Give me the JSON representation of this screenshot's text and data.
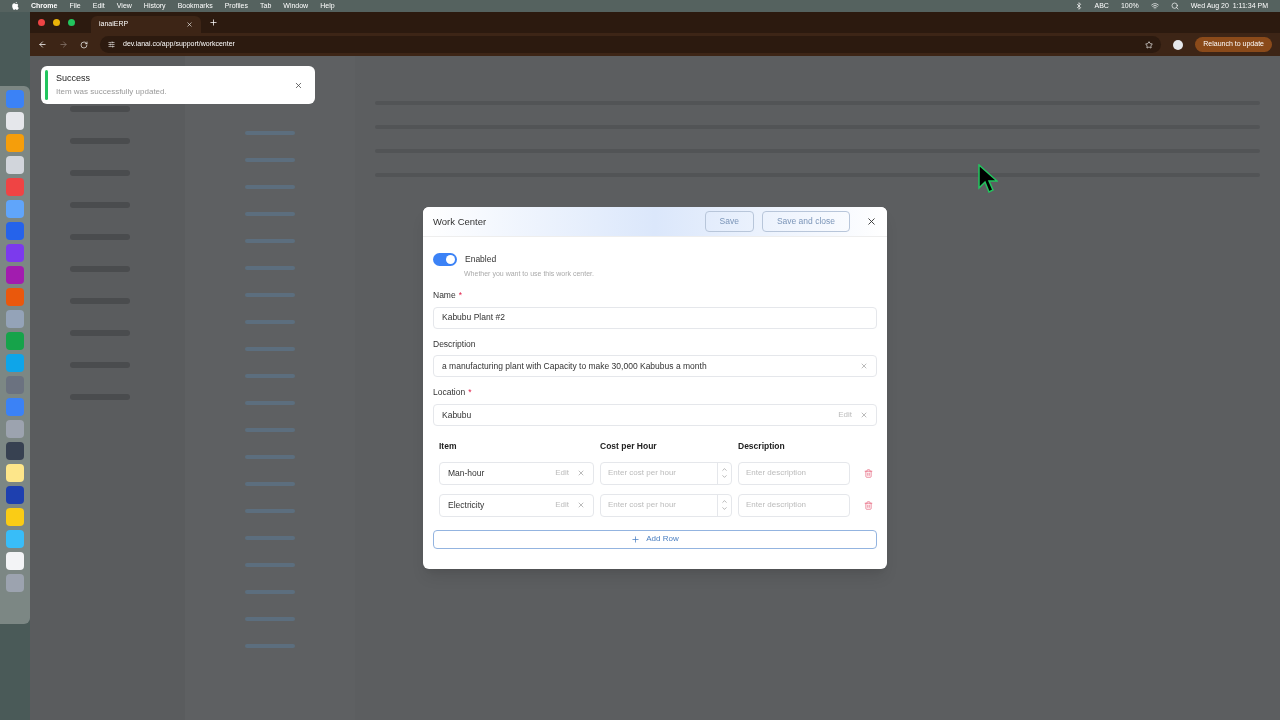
{
  "menubar": {
    "app": "Chrome",
    "menus": [
      "File",
      "Edit",
      "View",
      "History",
      "Bookmarks",
      "Profiles",
      "Tab",
      "Window",
      "Help"
    ],
    "status": [
      "ABC",
      "100%"
    ],
    "clock": "Wed Aug 20  1:11:34 PM"
  },
  "browser": {
    "tab_title": "ianaiERP",
    "url": "dev.ianai.co/app/support/workcenter",
    "relaunch_label": "Relaunch to update"
  },
  "toast": {
    "title": "Success",
    "message": "Item was successfully updated."
  },
  "dialog": {
    "title": "Work Center",
    "buttons": [
      {
        "label": "Save",
        "kind": "outline"
      },
      {
        "label": "Save and close",
        "kind": "outline"
      }
    ],
    "enabled": {
      "label": "Enabled",
      "hint": "Whether you want to use this work center.",
      "on": true
    },
    "fields": [
      {
        "label": "Name",
        "required_mark": "*",
        "value": "Kabubu Plant #2",
        "clearable": false
      },
      {
        "label": "Description",
        "value": "a manufacturing plant with Capacity to make 30,000 Kabubus a month",
        "clearable": true
      },
      {
        "label": "Location",
        "required_mark": "*",
        "value": "Kabubu",
        "edit_label": "Edit",
        "clearable": true
      }
    ],
    "table": {
      "columns": [
        "Item",
        "Cost per Hour",
        "Description"
      ],
      "rows": [
        {
          "item": "Man-hour",
          "edit_label": "Edit",
          "cost_placeholder": "Enter cost per hour",
          "description_placeholder": "Enter description"
        },
        {
          "item": "Electricity",
          "edit_label": "Edit",
          "cost_placeholder": "Enter cost per hour",
          "description_placeholder": "Enter description"
        }
      ]
    },
    "add_row": "Add Row"
  }
}
